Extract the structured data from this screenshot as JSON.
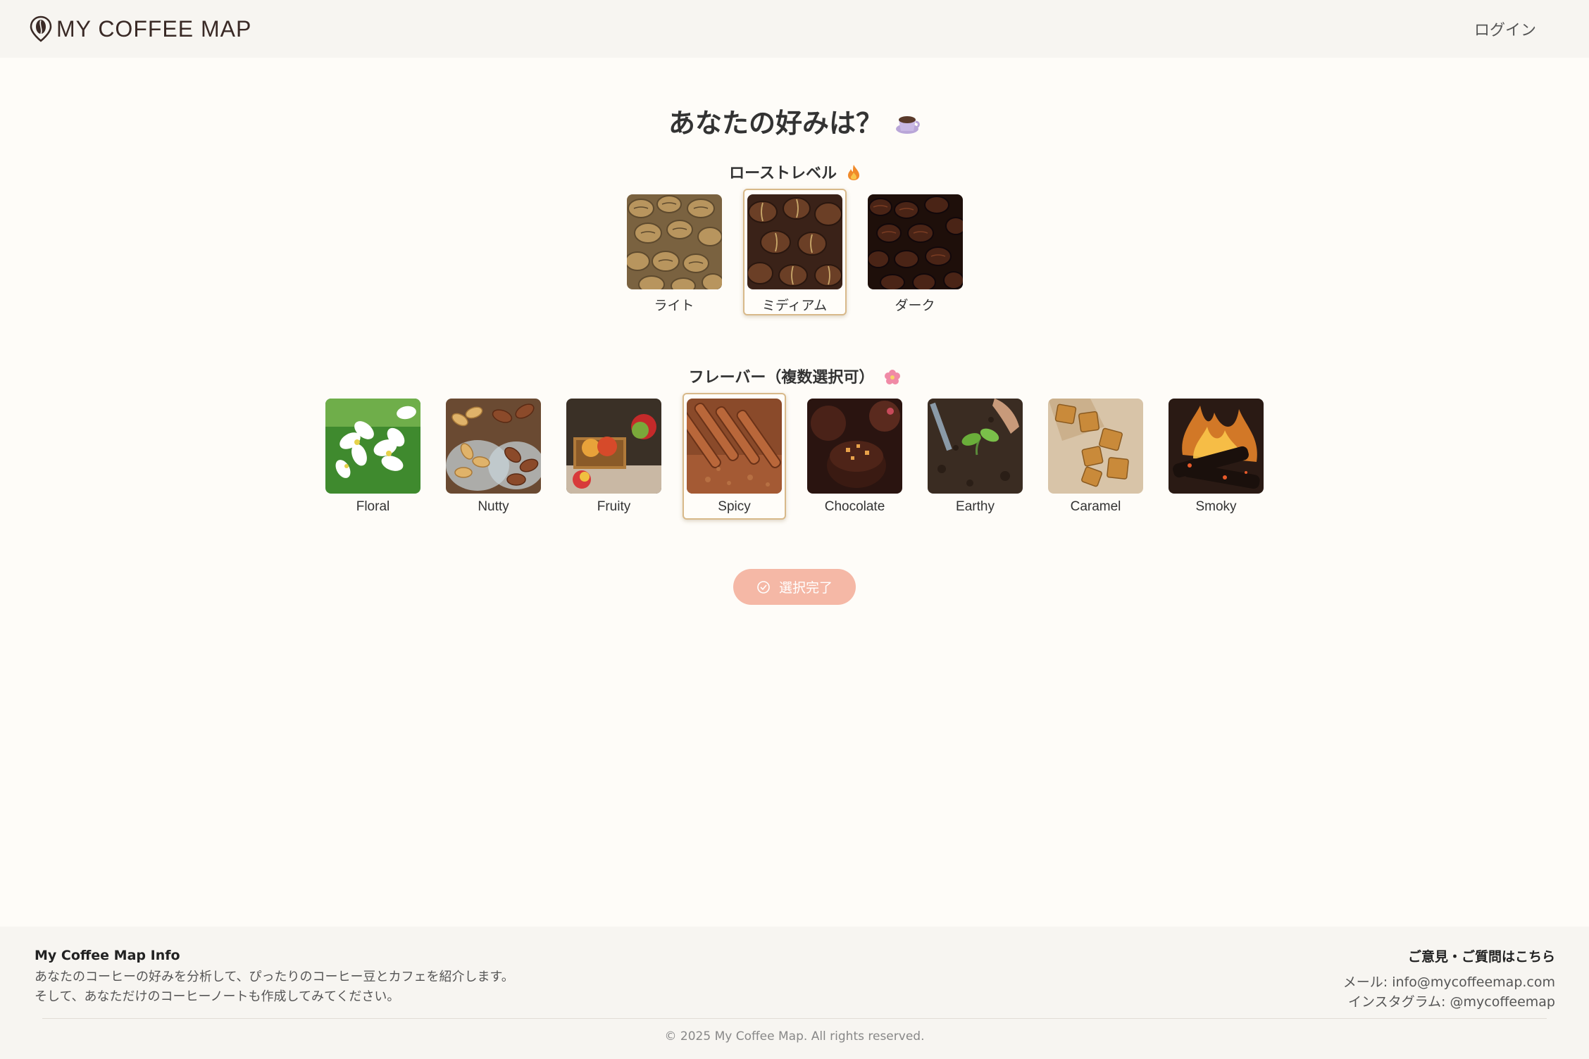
{
  "header": {
    "brand_name": "MY COFFEE MAP",
    "login_label": "ログイン"
  },
  "main": {
    "title": "あなたの好みは？",
    "title_icon": "coffee-cup-icon",
    "roast": {
      "title": "ローストレベル",
      "title_icon": "fire-icon",
      "options": [
        {
          "label": "ライト",
          "selected": false
        },
        {
          "label": "ミディアム",
          "selected": true
        },
        {
          "label": "ダーク",
          "selected": false
        }
      ]
    },
    "flavor": {
      "title": "フレーバー（複数選択可）",
      "title_icon": "flower-icon",
      "options": [
        {
          "label": "Floral",
          "selected": false
        },
        {
          "label": "Nutty",
          "selected": false
        },
        {
          "label": "Fruity",
          "selected": false
        },
        {
          "label": "Spicy",
          "selected": true
        },
        {
          "label": "Chocolate",
          "selected": false
        },
        {
          "label": "Earthy",
          "selected": false
        },
        {
          "label": "Caramel",
          "selected": false
        },
        {
          "label": "Smoky",
          "selected": false
        }
      ]
    },
    "submit_label": "選択完了"
  },
  "footer": {
    "info_title": "My Coffee Map Info",
    "info_line1": "あなたのコーヒーの好みを分析して、ぴったりのコーヒー豆とカフェを紹介します。",
    "info_line2": "そして、あなただけのコーヒーノートも作成してみてください。",
    "contact_title": "ご意見・ご質問はこちら",
    "email": "メール: info@mycoffeemap.com",
    "instagram": "インスタグラム: @mycoffeemap",
    "copyright": "© 2025 My Coffee Map. All rights reserved."
  },
  "colors": {
    "accent": "#f5b8a6",
    "selected_border": "#d8b98a",
    "header_bg": "#f7f5f1",
    "page_bg": "#fefcf8"
  }
}
